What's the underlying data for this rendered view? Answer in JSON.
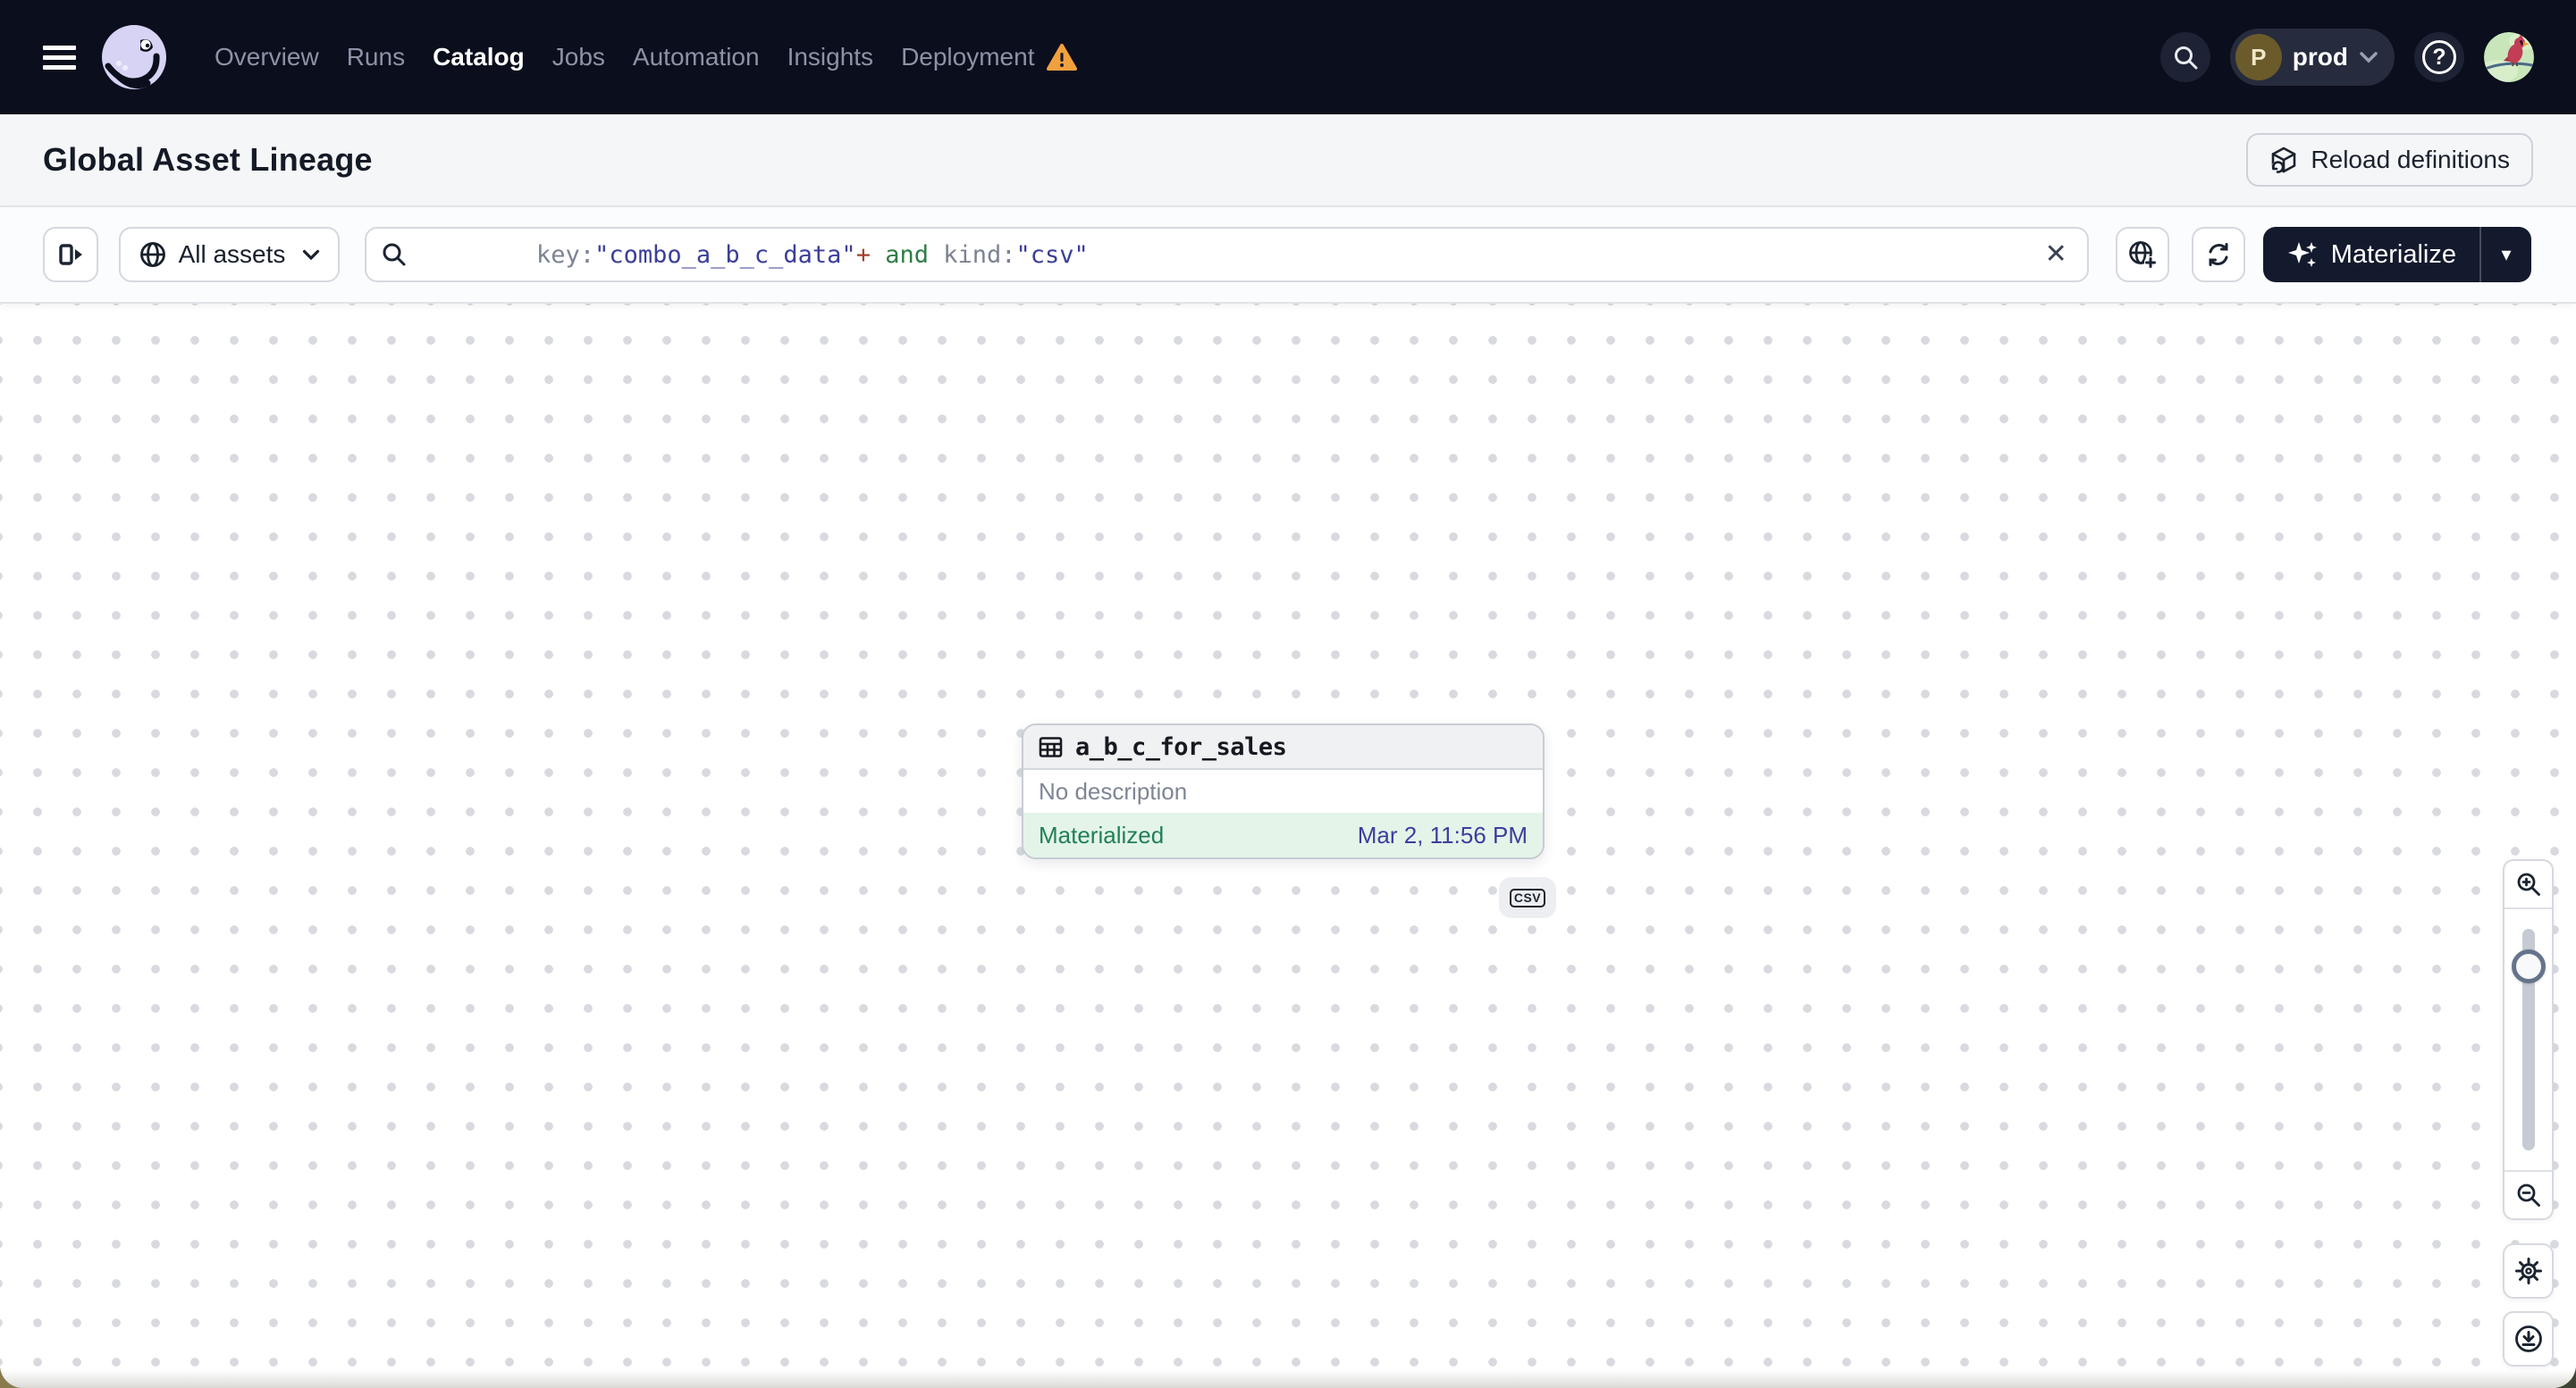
{
  "topbar": {
    "nav": [
      {
        "label": "Overview",
        "active": false,
        "warning": false
      },
      {
        "label": "Runs",
        "active": false,
        "warning": false
      },
      {
        "label": "Catalog",
        "active": true,
        "warning": false
      },
      {
        "label": "Jobs",
        "active": false,
        "warning": false
      },
      {
        "label": "Automation",
        "active": false,
        "warning": false
      },
      {
        "label": "Insights",
        "active": false,
        "warning": false
      },
      {
        "label": "Deployment",
        "active": false,
        "warning": true
      }
    ],
    "environment": {
      "initial": "P",
      "name": "prod"
    },
    "help_glyph": "?"
  },
  "header": {
    "title": "Global Asset Lineage",
    "reload_label": "Reload definitions"
  },
  "toolbar": {
    "scope_label": "All assets",
    "query": [
      {
        "text": "key:",
        "color": "#7B8393"
      },
      {
        "text": "\"combo_a_b_c_data\"",
        "color": "#3B3E99"
      },
      {
        "text": "+",
        "color": "#A3402F"
      },
      {
        "text": " and ",
        "color": "#2E7D46"
      },
      {
        "text": "kind:",
        "color": "#7B8393"
      },
      {
        "text": "\"csv\"",
        "color": "#3B3E99"
      }
    ],
    "materialize_label": "Materialize"
  },
  "graph": {
    "node": {
      "name": "a_b_c_for_sales",
      "description": "No description",
      "status": "Materialized",
      "timestamp": "Mar 2, 11:56 PM"
    },
    "kind_badge": "CSV",
    "control_icons": [
      "zoom-in",
      "zoom-slider",
      "zoom-out",
      "settings",
      "download"
    ]
  },
  "icons": {
    "clear": "✕",
    "caret_down": "▾"
  },
  "colors": {
    "topbar_bg": "#0B0E1C",
    "nav_inactive": "#8C93A6",
    "nav_active": "#FFFFFF",
    "warning_amber": "#F0A13F",
    "materialize_bg": "#141A2D",
    "materialized_text": "#218055",
    "materialized_bg": "#E4F4E9",
    "timestamp_text": "#3F3D9C",
    "env_avatar_bg": "#6B5B2B"
  }
}
